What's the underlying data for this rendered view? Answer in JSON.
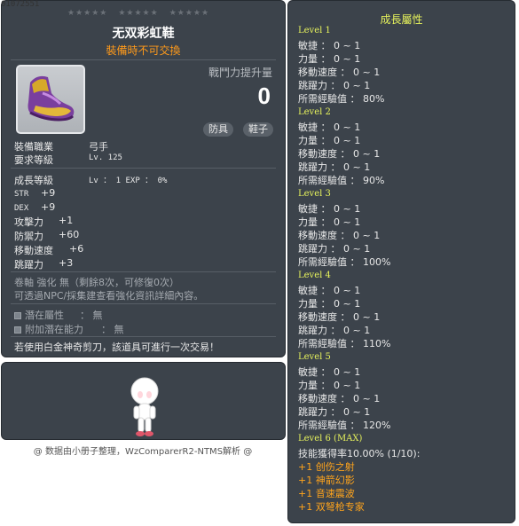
{
  "item_id": "01072551",
  "tooltip": {
    "stars": [
      "★★★★★",
      "★★★★★",
      "★★★★★"
    ],
    "name": "无双彩虹鞋",
    "trade_note": "裝備時不可交換",
    "power_label": "戰鬥力提升量",
    "power_value": "0",
    "tags": [
      "防具",
      "鞋子"
    ],
    "job_label": "裝備職業",
    "job_value": "弓手",
    "req_level_label": "要求等級",
    "req_level_value": "Lv. 125",
    "growth_label": "成長等級",
    "growth_value": "Lv ： 1   EXP ： 0%",
    "stats": [
      {
        "label": "STR",
        "value": "+9"
      },
      {
        "label": "DEX",
        "value": "+9"
      },
      {
        "label": "攻擊力",
        "value": "+1"
      },
      {
        "label": "防禦力",
        "value": "+60"
      },
      {
        "label": "移動速度",
        "value": "+6"
      },
      {
        "label": "跳躍力",
        "value": "+3"
      }
    ],
    "scroll_line": "卷軸 強化 無（剩餘8次，可修復0次）",
    "npc_line": "可透過NPC/採集建查看強化資訊詳細內容。",
    "potential_label": "潛在屬性",
    "potential_value": "： 無",
    "add_potential_label": "附加潛在能力",
    "add_potential_value": "： 無",
    "scissors_line": "若使用白金神奇剪刀，該道具可進行一次交易！"
  },
  "credit": "@ 数据由小册子整理，WzComparerR2-NTMS解析 @",
  "growth": {
    "title": "成長屬性",
    "levels": [
      {
        "title": "Level 1",
        "lines": [
          "敏捷 ： 0 ~ 1",
          "力量 ： 0 ~ 1",
          "移動速度 ： 0 ~ 1",
          "跳躍力 ： 0 ~ 1",
          "所需經驗值 ： 80%"
        ]
      },
      {
        "title": "Level 2",
        "lines": [
          "敏捷 ： 0 ~ 1",
          "力量 ： 0 ~ 1",
          "移動速度 ： 0 ~ 1",
          "跳躍力 ： 0 ~ 1",
          "所需經驗值 ： 90%"
        ]
      },
      {
        "title": "Level 3",
        "lines": [
          "敏捷 ： 0 ~ 1",
          "力量 ： 0 ~ 1",
          "移動速度 ： 0 ~ 1",
          "跳躍力 ： 0 ~ 1",
          "所需經驗值 ： 100%"
        ]
      },
      {
        "title": "Level 4",
        "lines": [
          "敏捷 ： 0 ~ 1",
          "力量 ： 0 ~ 1",
          "移動速度 ： 0 ~ 1",
          "跳躍力 ： 0 ~ 1",
          "所需經驗值 ： 110%"
        ]
      },
      {
        "title": "Level 5",
        "lines": [
          "敏捷 ： 0 ~ 1",
          "力量 ： 0 ~ 1",
          "移動速度 ： 0 ~ 1",
          "跳躍力 ： 0 ~ 1",
          "所需經驗值 ： 120%"
        ]
      }
    ],
    "max_title": "Level 6 (MAX)",
    "skill_rate": "技能獲得率10.00% (1/10):",
    "skills": [
      "+1 创伤之射",
      "+1 神箭幻影",
      "+1 音速震波",
      "+1 双弩枪专家"
    ]
  },
  "colors": {
    "panel_bg": "#3c434b",
    "yellow_title": "#e6f25c",
    "orange_text": "#ff9a1a",
    "skill_orange": "#ffa41c"
  },
  "icons": [
    "shoe-item-icon",
    "character-figure-icon"
  ]
}
